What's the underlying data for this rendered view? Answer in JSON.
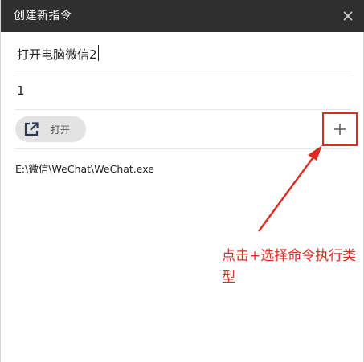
{
  "dialog": {
    "title": "创建新指令",
    "close_icon": "close-icon"
  },
  "form": {
    "name_value": "打开电脑微信2",
    "second_value": "1",
    "action_chip": {
      "icon": "open-external-icon",
      "label": "打开"
    },
    "add_icon": "plus-icon",
    "path_value": "E:\\微信\\WeChat\\WeChat.exe"
  },
  "annotation": {
    "text": "点击+选择命令执行类型",
    "color": "#e02b20"
  },
  "colors": {
    "titlebar": "#2f2f2f",
    "chip": "#e3e3e3",
    "highlight": "#e02b20"
  }
}
